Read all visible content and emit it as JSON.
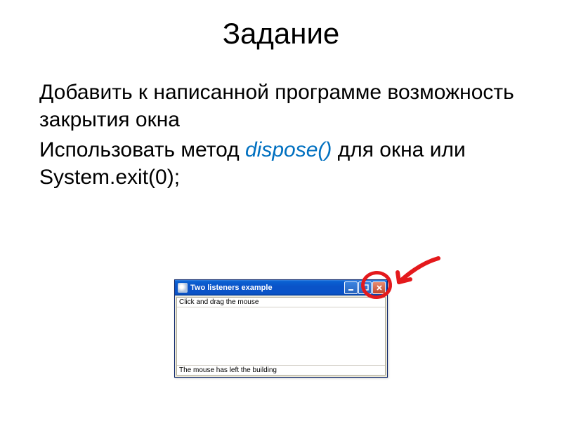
{
  "title": "Задание",
  "para1": "Добавить к написанной программе возможность закрытия окна",
  "para2a": "Использовать метод ",
  "method": "dispose()",
  "para2b": " для окна или System.exit(0);",
  "window": {
    "title": "Two listeners example",
    "top_text": "Click and drag the mouse",
    "bottom_text": "The mouse has left the building"
  },
  "buttons": {
    "min": "_",
    "max": "□",
    "close": "X"
  }
}
